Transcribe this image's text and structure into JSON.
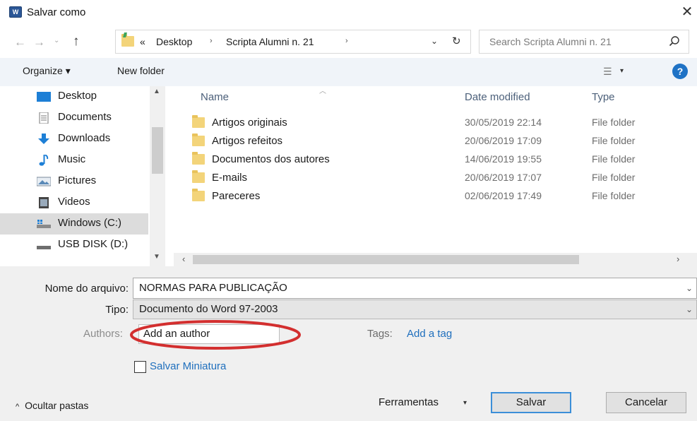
{
  "window": {
    "icon_text": "W",
    "title": "Salvar como",
    "close_glyph": "✕"
  },
  "navigation": {
    "back_glyph": "←",
    "forward_glyph": "→",
    "recent_glyph": "⌄",
    "up_glyph": "↑",
    "address": {
      "prefix": "«",
      "crumbs": [
        "Desktop",
        "Scripta Alumni n. 21"
      ],
      "separator": "›",
      "dropdown_glyph": "⌄",
      "refresh_glyph": "↻"
    },
    "search": {
      "placeholder": "Search Scripta Alumni n. 21"
    }
  },
  "toolbar": {
    "organize_label": "Organize ▾",
    "new_folder_label": "New folder",
    "view_glyph": "☰",
    "view_dropdown_glyph": "▾",
    "help_glyph": "?"
  },
  "sidebar": {
    "items": [
      {
        "label": "Desktop",
        "icon": "desktop-icon"
      },
      {
        "label": "Documents",
        "icon": "documents-icon"
      },
      {
        "label": "Downloads",
        "icon": "downloads-icon"
      },
      {
        "label": "Music",
        "icon": "music-icon"
      },
      {
        "label": "Pictures",
        "icon": "pictures-icon"
      },
      {
        "label": "Videos",
        "icon": "videos-icon"
      },
      {
        "label": "Windows (C:)",
        "icon": "drive-c-icon",
        "selected": true
      },
      {
        "label": "USB DISK (D:)",
        "icon": "usb-drive-icon"
      }
    ],
    "scroll_up_glyph": "▲",
    "scroll_down_glyph": "▼"
  },
  "file_list": {
    "columns": {
      "name": "Name",
      "date": "Date modified",
      "type": "Type"
    },
    "sort_glyph": "︿",
    "rows": [
      {
        "name": "Artigos originais",
        "date": "30/05/2019 22:14",
        "type": "File folder"
      },
      {
        "name": "Artigos refeitos",
        "date": "20/06/2019 17:09",
        "type": "File folder"
      },
      {
        "name": "Documentos dos autores",
        "date": "14/06/2019 19:55",
        "type": "File folder"
      },
      {
        "name": "E-mails",
        "date": "20/06/2019 17:07",
        "type": "File folder"
      },
      {
        "name": "Pareceres",
        "date": "02/06/2019 17:49",
        "type": "File folder"
      }
    ],
    "scroll_left_glyph": "‹",
    "scroll_right_glyph": "›"
  },
  "form": {
    "filename_label": "Nome do arquivo:",
    "filename_value": "NORMAS PARA PUBLICAÇÃO",
    "type_label": "Tipo:",
    "type_value": "Documento do Word 97-2003",
    "dropdown_glyph": "⌄",
    "authors_label": "Authors:",
    "authors_value": "Add an author",
    "tags_label": "Tags:",
    "tags_value": "Add a tag",
    "thumbnail_label": "Salvar Miniatura",
    "thumbnail_checked": false,
    "highlight_color": "#d32f2f"
  },
  "footer": {
    "hide_folders_glyph": "^",
    "hide_folders_label": "Ocultar pastas",
    "tools_label": "Ferramentas",
    "tools_glyph": "▾",
    "save_label": "Salvar",
    "cancel_label": "Cancelar"
  },
  "colors": {
    "accent": "#1f72c5",
    "link": "#1f6fbd",
    "toolbar_bg": "#f0f4f9",
    "panel_bg": "#f0f0f0"
  }
}
